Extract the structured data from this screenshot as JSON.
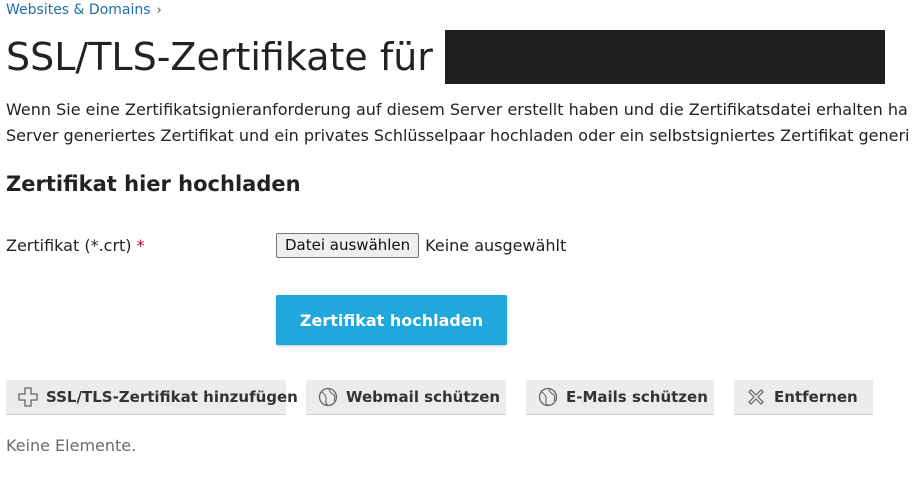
{
  "breadcrumb": {
    "label": "Websites & Domains",
    "chevron": "›"
  },
  "page": {
    "title": "SSL/TLS-Zertifikate für",
    "intro_line1": "Wenn Sie eine Zertifikatsignieranforderung auf diesem Server erstellt haben und die Zertifikatsdatei erhalten ha",
    "intro_line2": "Server generiertes Zertifikat und ein privates Schlüsselpaar hochladen oder ein selbstsigniertes Zertifikat generi"
  },
  "upload_section": {
    "heading": "Zertifikat hier hochladen",
    "field_label": "Zertifikat (*.crt)",
    "required_mark": "*",
    "choose_file_label": "Datei auswählen",
    "file_status": "Keine ausgewählt",
    "upload_button_label": "Zertifikat hochladen"
  },
  "toolbar": {
    "add_certificate_label": "SSL/TLS-Zertifikat hinzufügen",
    "secure_webmail_label": "Webmail schützen",
    "secure_mail_label": "E-Mails schützen",
    "remove_label": "Entfernen"
  },
  "list": {
    "empty_text": "Keine Elemente."
  },
  "colors": {
    "accent": "#20a7dc",
    "link": "#1d6fa5",
    "required": "#c0003c"
  }
}
